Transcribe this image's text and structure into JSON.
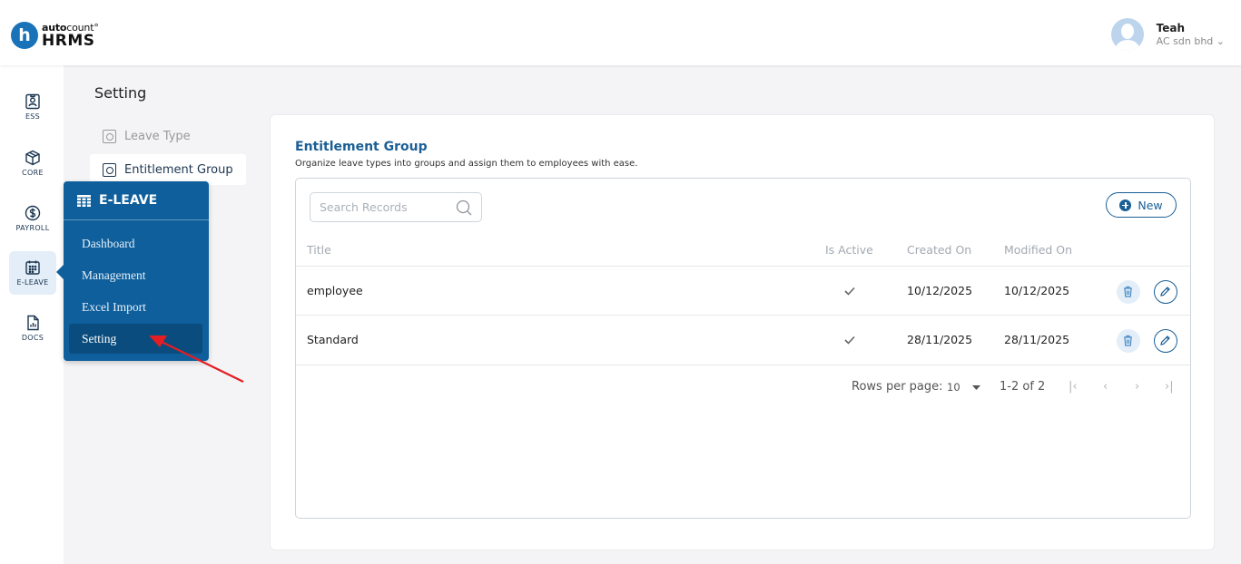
{
  "brand": {
    "top_bold": "auto",
    "top_light": "count",
    "mark": "°",
    "bottom": "HRMS",
    "logo_letter": "h"
  },
  "user": {
    "name": "Teah",
    "company": "AC sdn bhd",
    "chevron": "⌄"
  },
  "rail": [
    {
      "label": "ESS",
      "icon": "id-card-icon"
    },
    {
      "label": "CORE",
      "icon": "cube-icon"
    },
    {
      "label": "PAYROLL",
      "icon": "dollar-icon"
    },
    {
      "label": "E-LEAVE",
      "icon": "calendar-icon",
      "active": true
    },
    {
      "label": "DOCS",
      "icon": "document-chart-icon"
    }
  ],
  "setting": {
    "title": "Setting",
    "items": [
      {
        "label": "Leave Type"
      },
      {
        "label": "Entitlement Group",
        "active": true
      }
    ]
  },
  "flyout": {
    "title": "E-LEAVE",
    "items": [
      {
        "label": "Dashboard"
      },
      {
        "label": "Management"
      },
      {
        "label": "Excel Import"
      },
      {
        "label": "Setting",
        "active": true
      }
    ]
  },
  "main": {
    "title": "Entitlement Group",
    "description": "Organize leave types into groups and assign them to employees with ease.",
    "search_placeholder": "Search Records",
    "new_label": "New",
    "columns": [
      "Title",
      "Is Active",
      "Created On",
      "Modified On"
    ],
    "rows": [
      {
        "title": "employee",
        "active": "✓",
        "created": "10/12/2025",
        "modified": "10/12/2025"
      },
      {
        "title": "Standard",
        "active": "✓",
        "created": "28/11/2025",
        "modified": "28/11/2025"
      }
    ],
    "pagination": {
      "rows_label": "Rows per page:",
      "rows_value": "10",
      "range": "1-2 of 2",
      "first": "|‹",
      "prev": "‹",
      "next": "›",
      "last": "›|"
    }
  },
  "colors": {
    "primary": "#1a5f95",
    "flyout": "#0e5f9c",
    "flyout_active": "#0a4c7d",
    "annotation": "#e31e24"
  }
}
